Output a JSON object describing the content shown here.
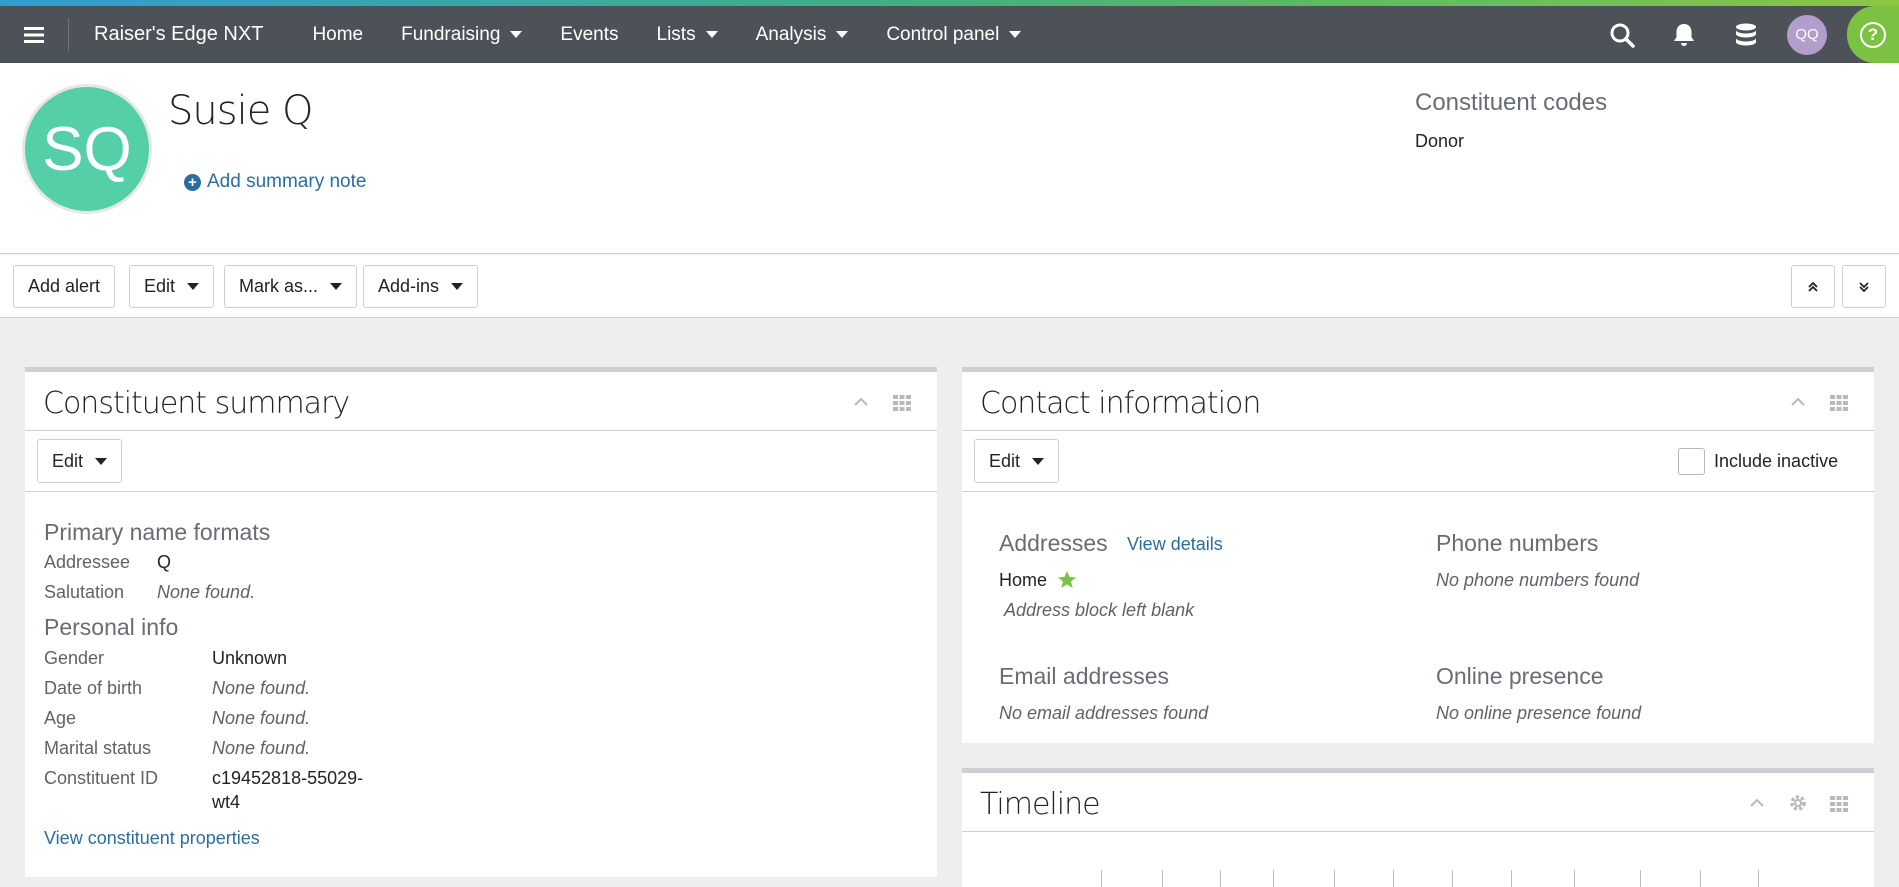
{
  "topnav": {
    "brand": "Raiser's Edge NXT",
    "items": [
      "Home",
      "Fundraising",
      "Events",
      "Lists",
      "Analysis",
      "Control panel"
    ],
    "user_initials": "QQ"
  },
  "record": {
    "initials": "SQ",
    "name": "Susie Q",
    "add_note_label": "Add summary note",
    "codes_heading": "Constituent codes",
    "codes_value": "Donor"
  },
  "actions": {
    "add_alert": "Add alert",
    "edit": "Edit",
    "mark_as": "Mark as...",
    "add_ins": "Add-ins"
  },
  "summary": {
    "title": "Constituent summary",
    "edit": "Edit",
    "name_formats_heading": "Primary name formats",
    "addressee_label": "Addressee",
    "addressee_value": "Q",
    "salutation_label": "Salutation",
    "salutation_value": "None found.",
    "personal_heading": "Personal info",
    "gender_label": "Gender",
    "gender_value": "Unknown",
    "dob_label": "Date of birth",
    "dob_value": "None found.",
    "age_label": "Age",
    "age_value": "None found.",
    "marital_label": "Marital status",
    "marital_value": "None found.",
    "id_label": "Constituent ID",
    "id_value_line1": "c19452818-55029-",
    "id_value_line2": "wt4",
    "view_props": "View constituent properties"
  },
  "contact": {
    "title": "Contact information",
    "edit": "Edit",
    "include_inactive": "Include inactive",
    "addresses_heading": "Addresses",
    "view_details": "View details",
    "home_label": "Home",
    "address_blank": "Address block left blank",
    "phones_heading": "Phone numbers",
    "no_phones": "No phone numbers found",
    "emails_heading": "Email addresses",
    "no_emails": "No email addresses found",
    "online_heading": "Online presence",
    "no_online": "No online presence found"
  },
  "timeline": {
    "title": "Timeline"
  },
  "colors": {
    "nav_bg": "#4d5259",
    "avatar_lg": "#55cfa7",
    "avatar_sm": "#b39ecb",
    "link": "#2a6ea0",
    "help": "#7cc242",
    "primary_star": "#7cc242"
  }
}
